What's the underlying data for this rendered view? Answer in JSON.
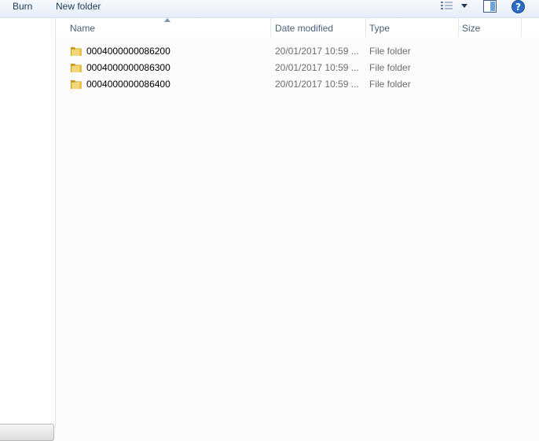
{
  "toolbar": {
    "burn_label": "Burn",
    "new_folder_label": "New folder",
    "views_icon": "details-view-icon",
    "views_dropdown_icon": "dropdown-arrow-icon",
    "preview_icon": "preview-pane-icon",
    "help_icon": "help-icon"
  },
  "columns": {
    "name": "Name",
    "date_modified": "Date modified",
    "type": "Type",
    "size": "Size"
  },
  "files": [
    {
      "name": "0004000000086200",
      "date": "20/01/2017 10:59 ...",
      "type": "File folder",
      "size": ""
    },
    {
      "name": "0004000000086300",
      "date": "20/01/2017 10:59 ...",
      "type": "File folder",
      "size": ""
    },
    {
      "name": "0004000000086400",
      "date": "20/01/2017 10:59 ...",
      "type": "File folder",
      "size": ""
    }
  ],
  "colors": {
    "folder": "#e8c04a",
    "help": "#2a6bc6",
    "text": "#1e395b"
  }
}
